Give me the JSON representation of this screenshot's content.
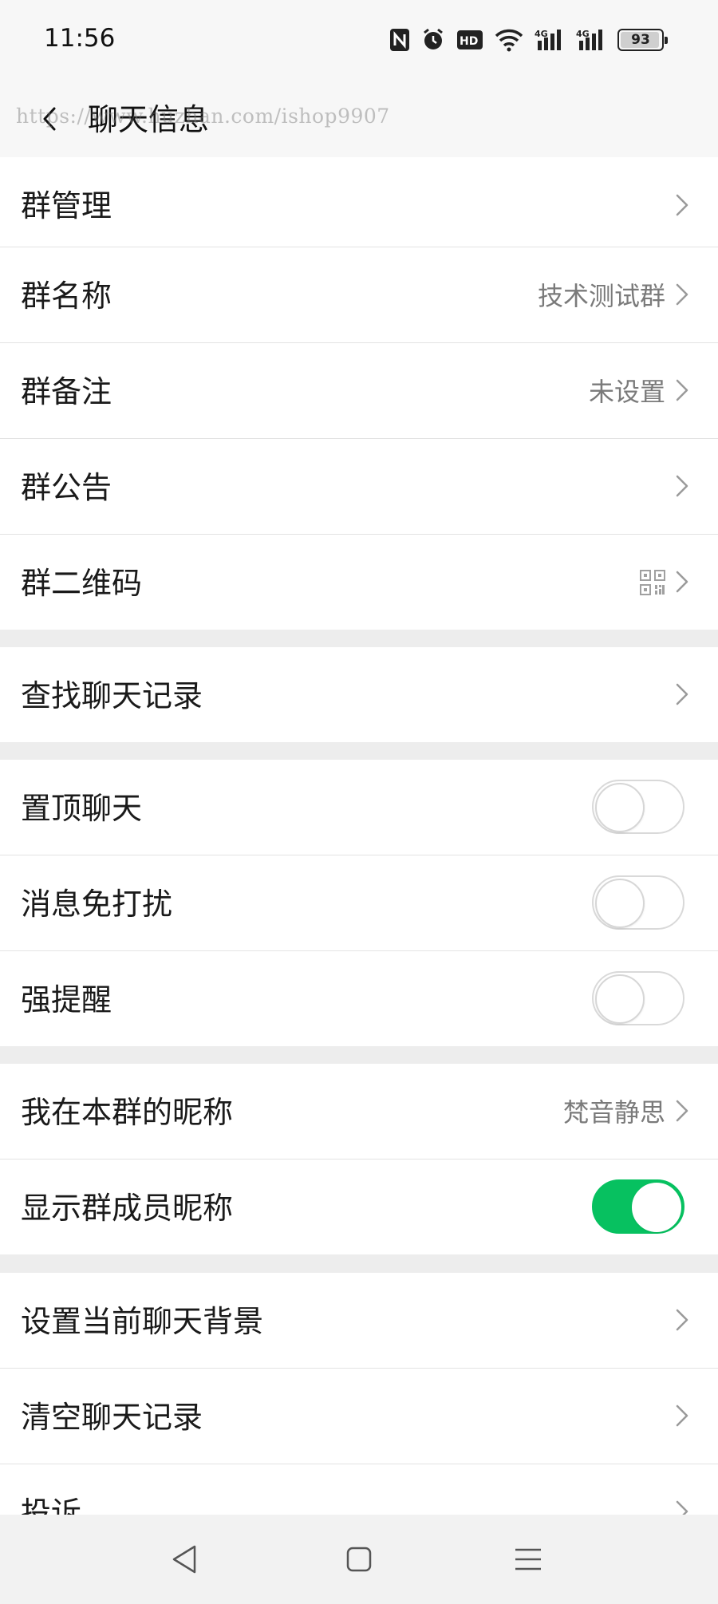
{
  "status_bar": {
    "time": "11:56",
    "battery_level": "93",
    "icons": [
      "nfc-icon",
      "alarm-icon",
      "hd-icon",
      "wifi-icon",
      "signal-4g-icon",
      "signal-4g-icon",
      "battery-icon"
    ]
  },
  "header": {
    "title": "聊天信息",
    "watermark": "https://www.huzhan.com/ishop9907"
  },
  "rows": {
    "group_manage": {
      "label": "群管理"
    },
    "group_name": {
      "label": "群名称",
      "value": "技术测试群"
    },
    "group_remark": {
      "label": "群备注",
      "value": "未设置"
    },
    "group_notice": {
      "label": "群公告"
    },
    "group_qrcode": {
      "label": "群二维码"
    },
    "search_history": {
      "label": "查找聊天记录"
    },
    "pin_chat": {
      "label": "置顶聊天",
      "toggle": "off"
    },
    "mute": {
      "label": "消息免打扰",
      "toggle": "off"
    },
    "strong_remind": {
      "label": "强提醒",
      "toggle": "off"
    },
    "my_nickname": {
      "label": "我在本群的昵称",
      "value": "梵音静思"
    },
    "show_nicknames": {
      "label": "显示群成员昵称",
      "toggle": "on"
    },
    "set_background": {
      "label": "设置当前聊天背景"
    },
    "clear_history": {
      "label": "清空聊天记录"
    },
    "complain": {
      "label": "投诉"
    }
  },
  "colors": {
    "accent_green": "#07c160",
    "background": "#ededed",
    "row_bg": "#ffffff"
  }
}
